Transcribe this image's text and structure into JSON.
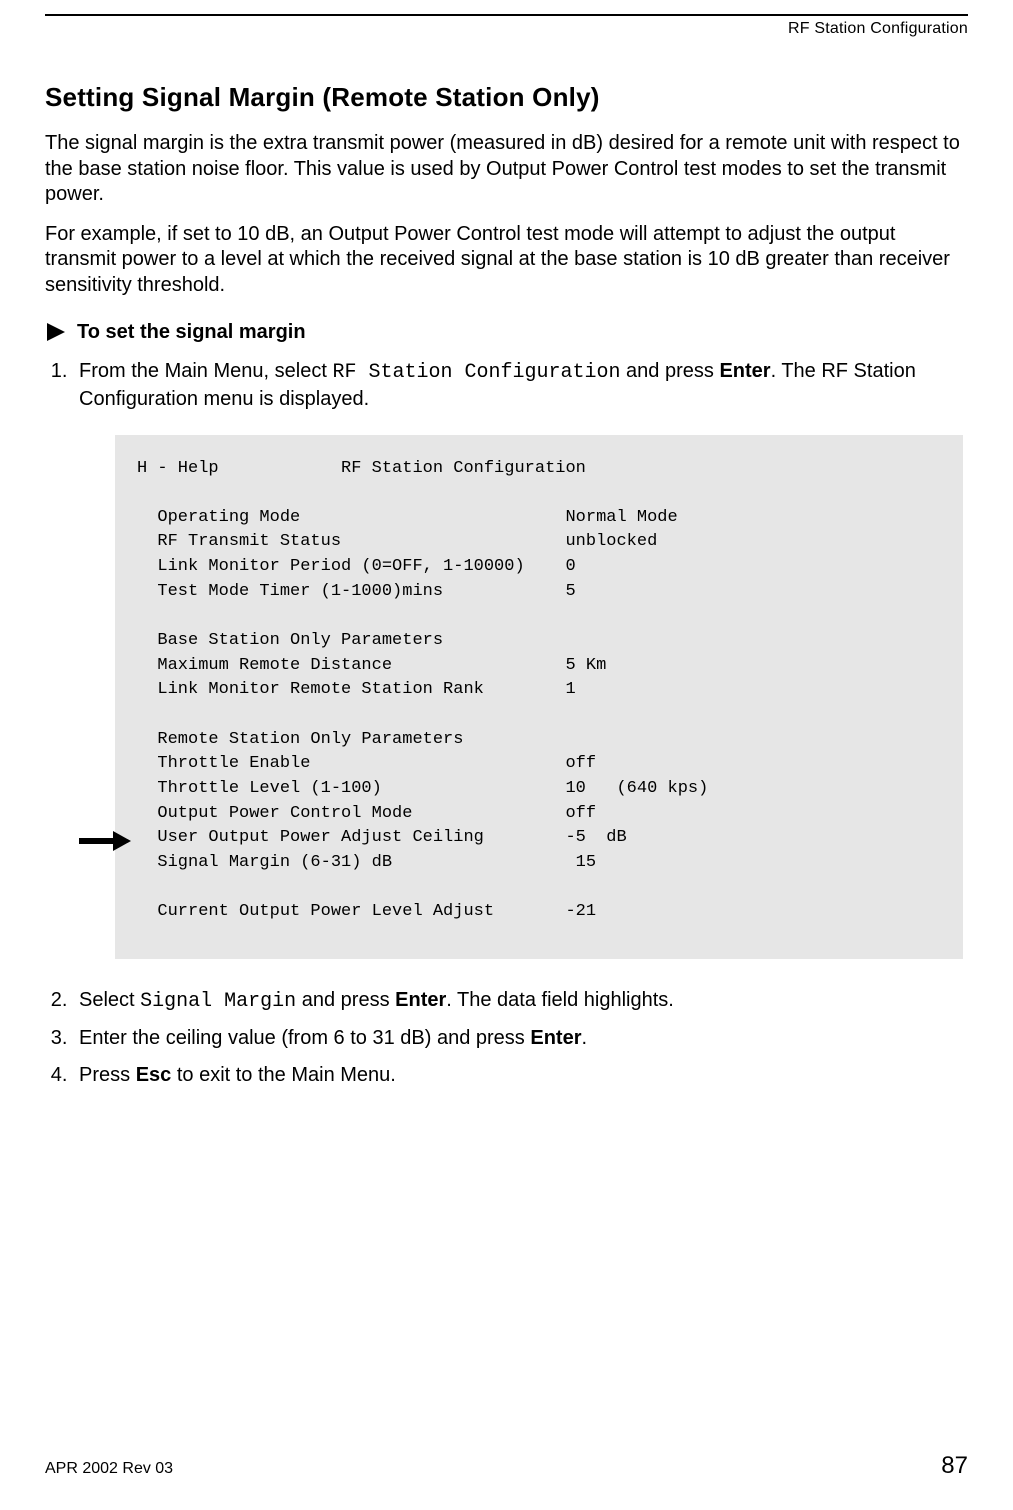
{
  "header": {
    "running_head": "RF Station Configuration"
  },
  "title": "Setting Signal Margin (Remote Station Only)",
  "para1": "The signal margin is the extra transmit power (measured in dB) desired for a remote unit with respect to the base station noise floor. This value is used by Output Power Control test modes to set the transmit power.",
  "para2": "For example, if set to 10 dB, an Output Power Control test mode will attempt to adjust the output transmit power to a level at which the received signal at the base station is 10 dB greater than receiver sensitivity threshold.",
  "proc_label": "To set the signal margin",
  "step1": {
    "prefix": "From the Main Menu, select ",
    "code": "RF Station Configuration",
    "mid": " and press ",
    "key": "Enter",
    "suffix": ". The RF Station Configuration menu is displayed."
  },
  "terminal": "H - Help            RF Station Configuration\n\n  Operating Mode                          Normal Mode\n  RF Transmit Status                      unblocked\n  Link Monitor Period (0=OFF, 1-10000)    0\n  Test Mode Timer (1-1000)mins            5\n\n  Base Station Only Parameters\n  Maximum Remote Distance                 5 Km\n  Link Monitor Remote Station Rank        1\n\n  Remote Station Only Parameters\n  Throttle Enable                         off\n  Throttle Level (1-100)                  10   (640 kps)\n  Output Power Control Mode               off\n  User Output Power Adjust Ceiling        -5  dB\n  Signal Margin (6-31) dB                  15\n\n  Current Output Power Level Adjust       -21",
  "step2": {
    "prefix": "Select ",
    "code": "Signal Margin",
    "mid": " and press ",
    "key": "Enter",
    "suffix": ". The data field highlights."
  },
  "step3": {
    "prefix": "Enter the ceiling value (from 6 to 31 dB) and press ",
    "key": "Enter",
    "suffix": "."
  },
  "step4": {
    "prefix": "Press ",
    "key": "Esc",
    "suffix": " to exit to the Main Menu."
  },
  "footer": {
    "rev": "APR 2002 Rev 03",
    "page": "87"
  }
}
